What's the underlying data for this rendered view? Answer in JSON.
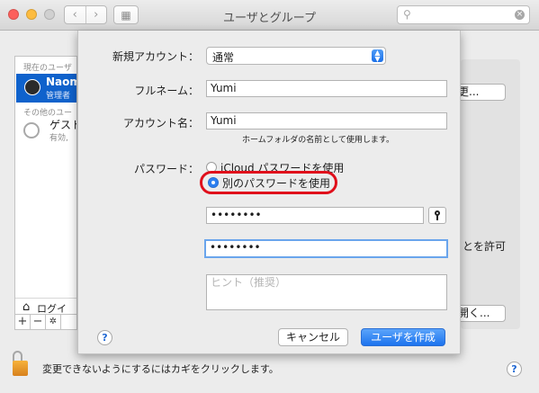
{
  "window": {
    "title": "ユーザとグループ",
    "search_placeholder": "",
    "nav_back": "‹",
    "nav_forward": "›",
    "grid_icon": "▦"
  },
  "left_panel": {
    "current_header": "現在のユーザ",
    "current_user_name": "Naom",
    "current_user_role": "管理者",
    "others_header": "その他のユー",
    "guest_name": "ゲスト",
    "guest_sub": "有効, ",
    "login_label": "ログイ",
    "toolbar": [
      "+",
      "−",
      "✲"
    ]
  },
  "right_panel": {
    "change_button": "更...",
    "allow_text": "とを許可",
    "open_button": "開く..."
  },
  "sheet": {
    "new_account_label": "新規アカウント：",
    "new_account_value": "通常",
    "fullname_label": "フルネーム：",
    "fullname_value": "Yumi",
    "account_label": "アカウント名：",
    "account_value": "Yumi",
    "account_note": "ホームフォルダの名前として使用します。",
    "password_label": "パスワード：",
    "radio_icloud": "iCloud パスワードを使用",
    "radio_other": "別のパスワードを使用",
    "password_value": "••••••••",
    "verify_value": "••••••••",
    "hint_placeholder": "ヒント（推奨）",
    "help": "?",
    "cancel_button": "キャンセル",
    "create_button": "ユーザを作成"
  },
  "bottom": {
    "lock_text": "変更できないようにするにはカギをクリックします。",
    "help": "?"
  }
}
